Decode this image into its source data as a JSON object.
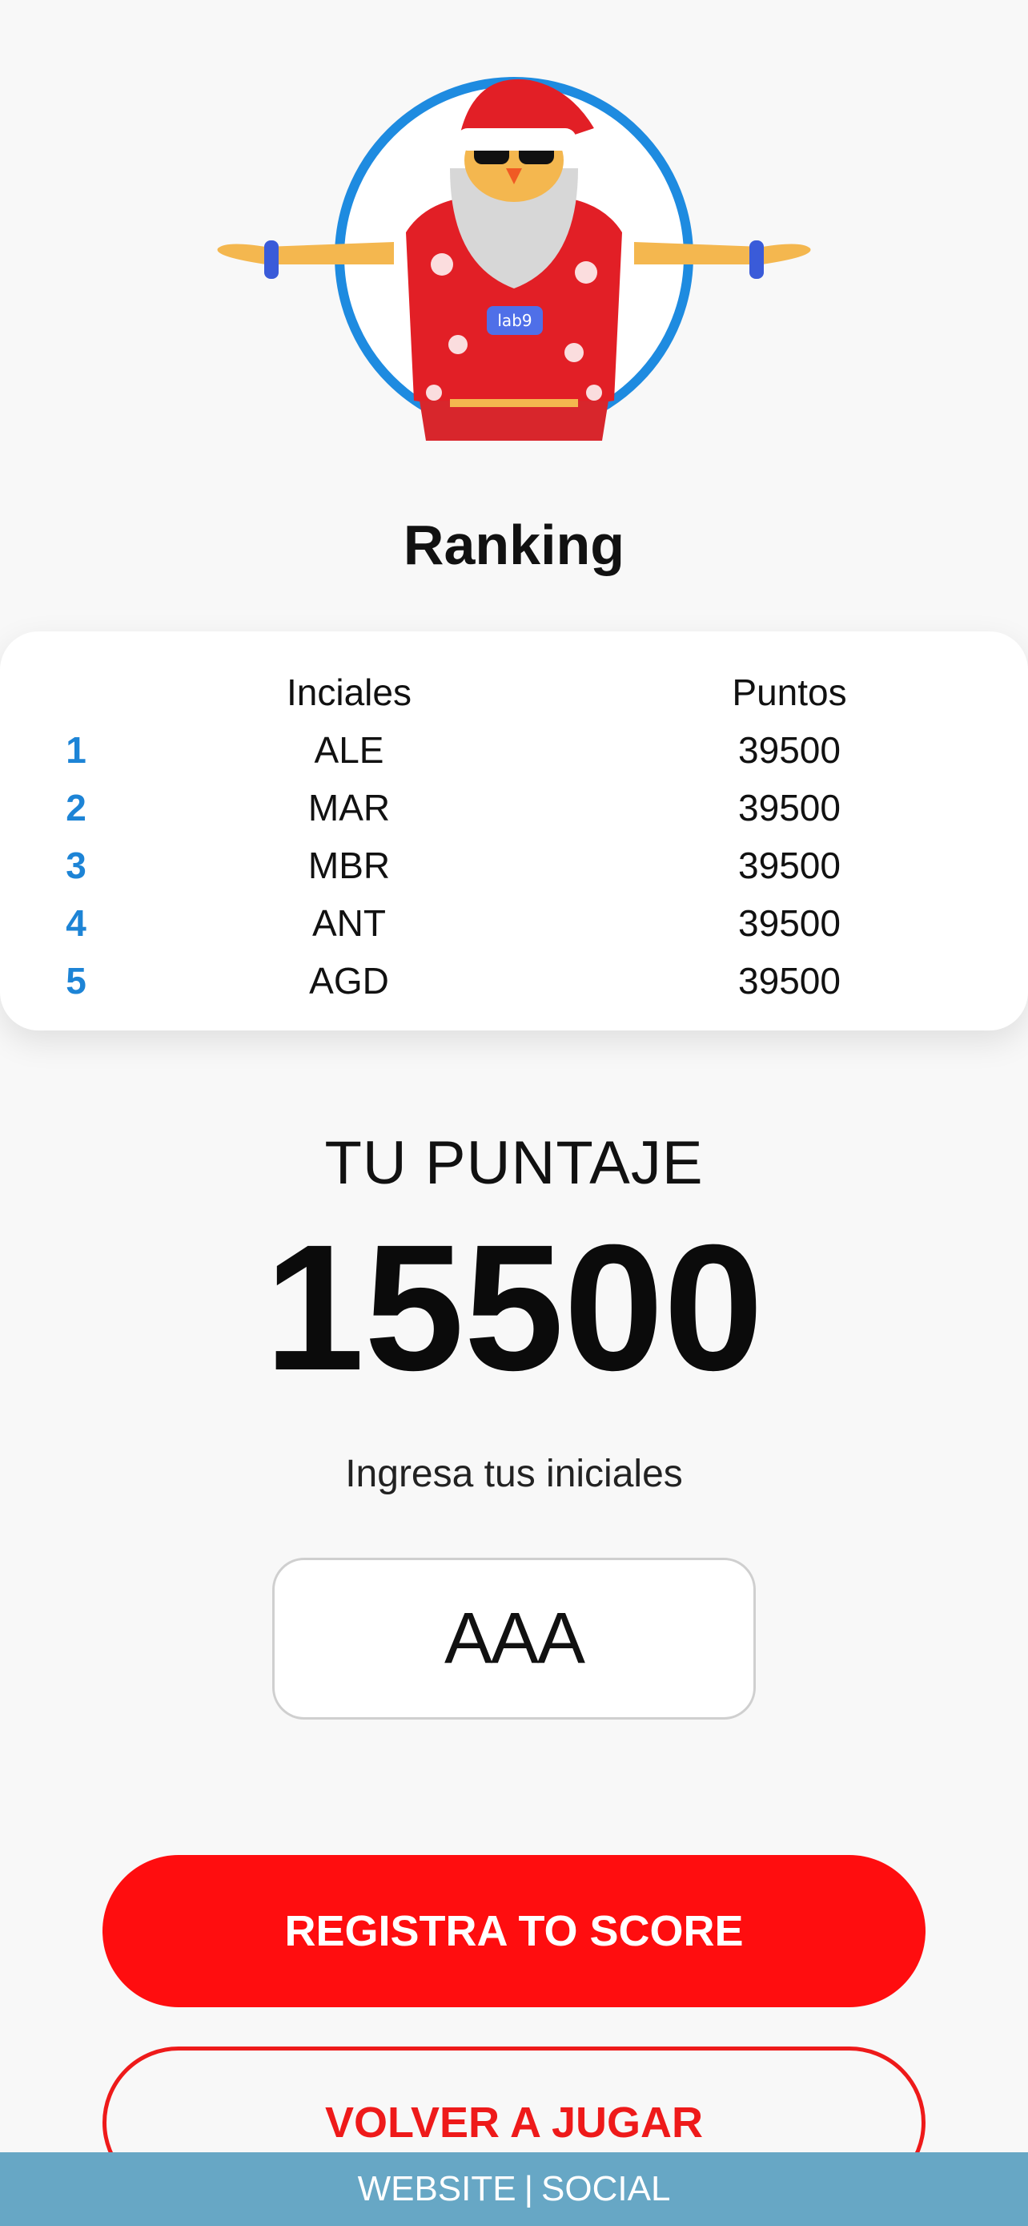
{
  "header": {
    "title": "Ranking"
  },
  "ranking": {
    "columns": {
      "initials": "Inciales",
      "points": "Puntos"
    },
    "rows": [
      {
        "rank": "1",
        "initials": "ALE",
        "points": "39500"
      },
      {
        "rank": "2",
        "initials": "MAR",
        "points": "39500"
      },
      {
        "rank": "3",
        "initials": "MBR",
        "points": "39500"
      },
      {
        "rank": "4",
        "initials": "ANT",
        "points": "39500"
      },
      {
        "rank": "5",
        "initials": "AGD",
        "points": "39500"
      }
    ]
  },
  "score": {
    "label": "TU PUNTAJE",
    "value": "15500"
  },
  "initials_input": {
    "label": "Ingresa tus iniciales",
    "value": "AAA"
  },
  "buttons": {
    "register": "REGISTRA TO SCORE",
    "play_again": "VOLVER A JUGAR"
  },
  "mascot": {
    "badge_text": "lab9",
    "icon": "santa-mascot-icon"
  },
  "footer": {
    "website": "WEBSITE",
    "separator": "|",
    "social": "SOCIAL"
  },
  "colors": {
    "rank_blue": "#1d84d6",
    "primary_red": "#ff0d0f",
    "footer_blue": "#67a7c5",
    "circle_blue": "#1e8be0"
  }
}
